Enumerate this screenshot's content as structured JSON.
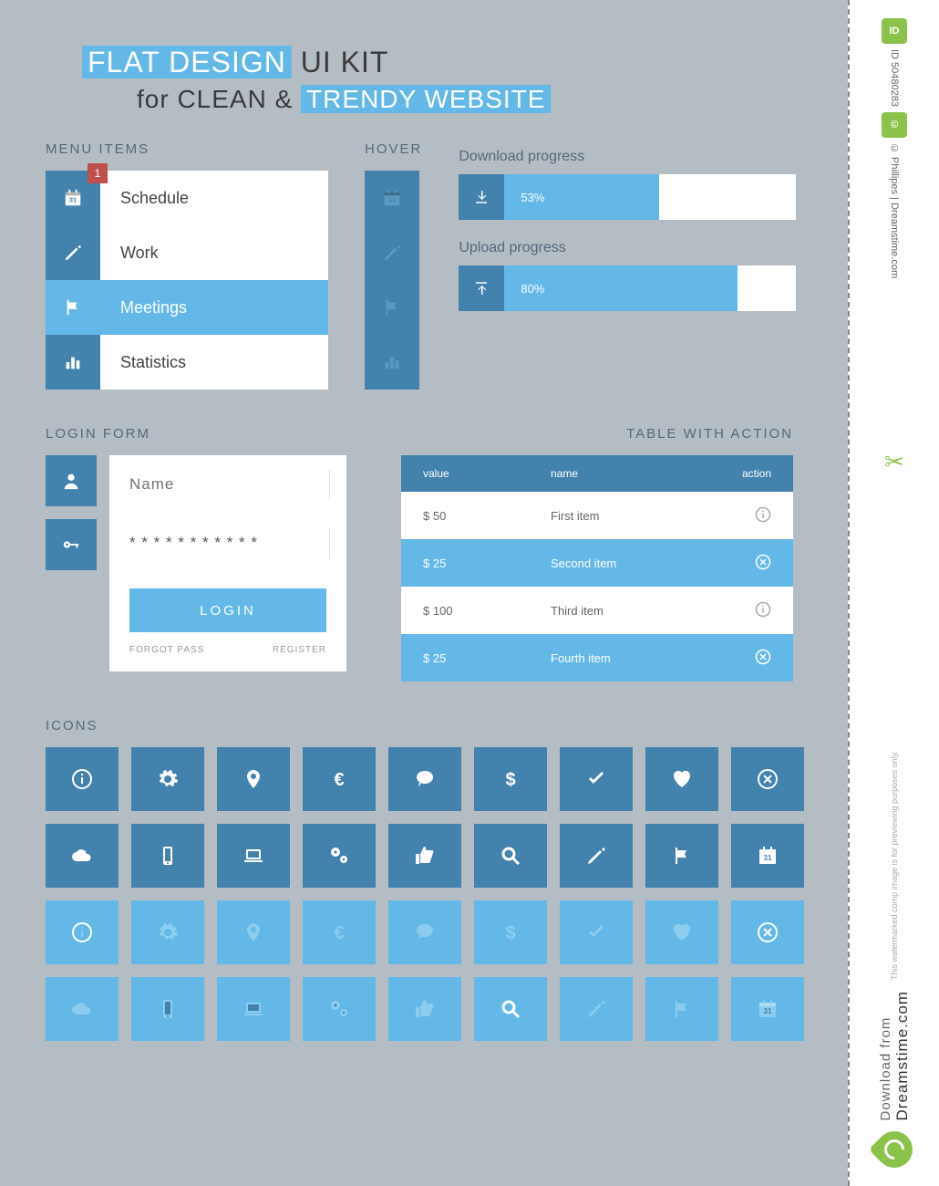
{
  "header": {
    "title_pre": "FLAT DESIGN",
    "title_post": "UI KIT",
    "subtitle_pre": "for CLEAN &",
    "subtitle_post": "TRENDY WEBSITE"
  },
  "sections": {
    "menu": "MENU ITEMS",
    "hover": "HOVER",
    "login": "LOGIN FORM",
    "table": "TABLE WITH ACTION",
    "icons": "ICONS"
  },
  "menu": {
    "items": [
      {
        "label": "Schedule",
        "icon": "calendar",
        "badge": "1"
      },
      {
        "label": "Work",
        "icon": "pencil"
      },
      {
        "label": "Meetings",
        "icon": "flag",
        "active": true
      },
      {
        "label": "Statistics",
        "icon": "bars"
      }
    ]
  },
  "hover": {
    "items": [
      "calendar",
      "pencil",
      "flag",
      "bars"
    ]
  },
  "progress": {
    "download": {
      "label": "Download progress",
      "value": "53%",
      "pct": 53
    },
    "upload": {
      "label": "Upload progress",
      "value": "80%",
      "pct": 80
    }
  },
  "login": {
    "name_placeholder": "Name",
    "password_value": "* * * * * * * * * * *",
    "button": "LOGIN",
    "forgot": "FORGOT PASS",
    "register": "REGISTER"
  },
  "table": {
    "head": {
      "value": "value",
      "name": "name",
      "action": "action"
    },
    "rows": [
      {
        "value": "$ 50",
        "name": "First item",
        "action": "info",
        "style": "white"
      },
      {
        "value": "$ 25",
        "name": "Second item",
        "action": "cancel",
        "style": "blue"
      },
      {
        "value": "$ 100",
        "name": "Third item",
        "action": "info",
        "style": "white"
      },
      {
        "value": "$ 25",
        "name": "Fourth item",
        "action": "cancel",
        "style": "blue"
      }
    ]
  },
  "icon_grid": {
    "row1": [
      "info",
      "gear",
      "pin",
      "euro",
      "chat",
      "dollar",
      "check",
      "heart",
      "cancel"
    ],
    "row2": [
      "cloud",
      "phone",
      "laptop",
      "gears",
      "like",
      "search",
      "pencil",
      "flag",
      "calendar"
    ]
  },
  "watermark": {
    "id": "ID 50480283",
    "credit": "© Phillipes | Dreamstime.com",
    "download_from": "Download from",
    "site": "Dreamstime.com",
    "note": "This watermarked comp image is for previewing purposes only."
  }
}
